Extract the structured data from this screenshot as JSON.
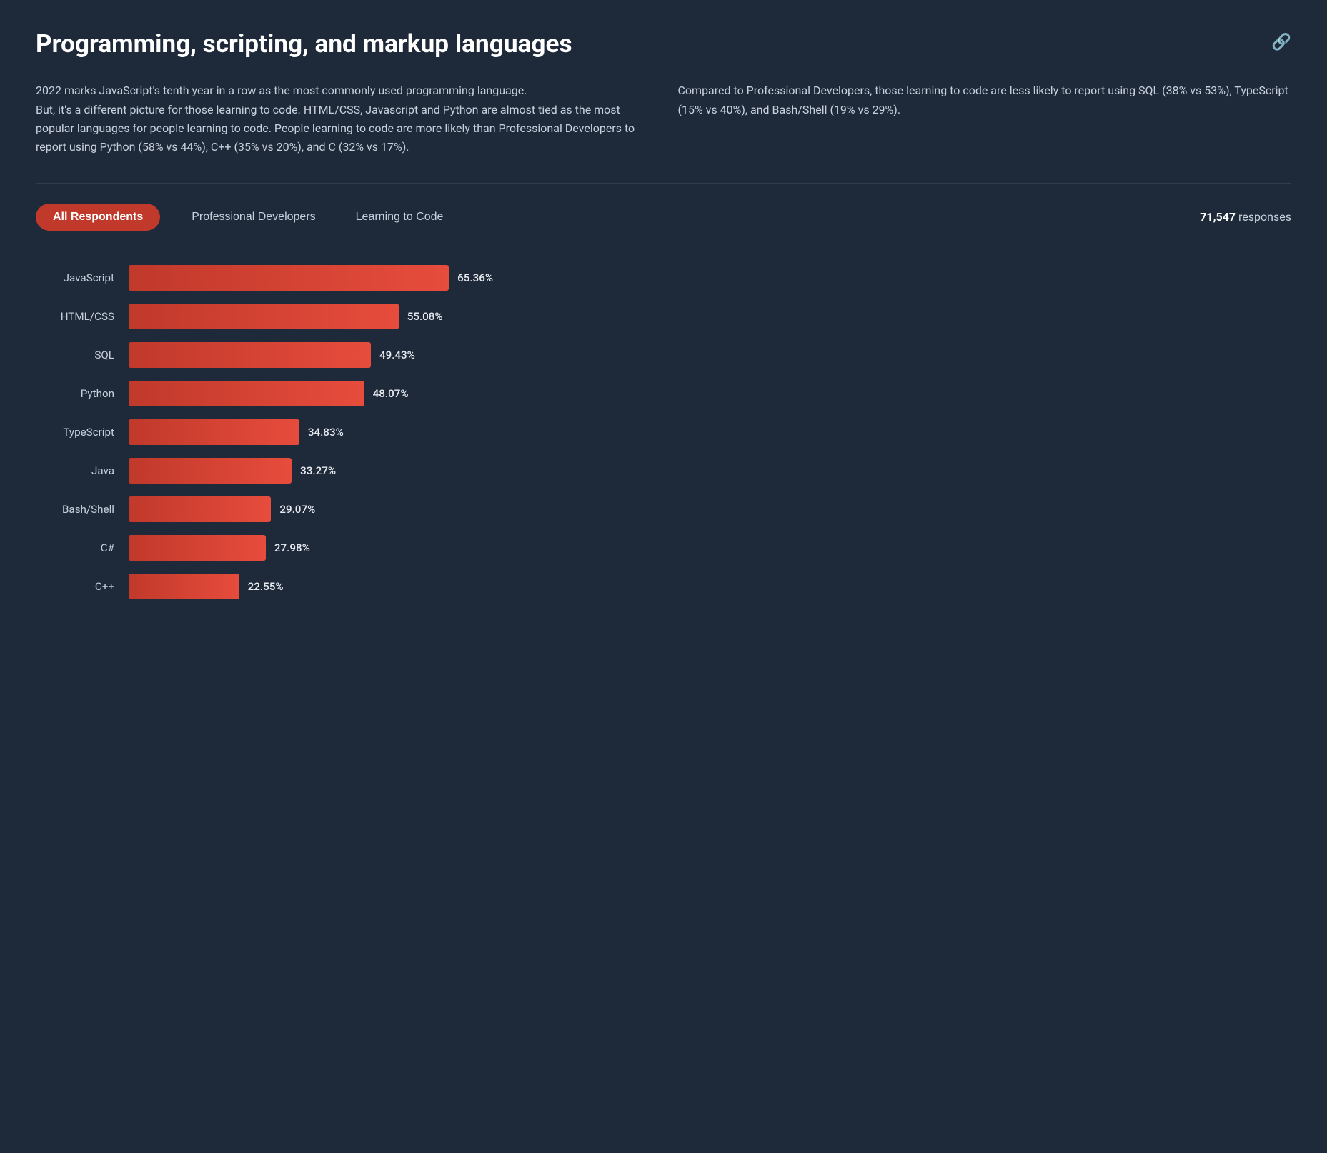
{
  "header": {
    "title": "Programming, scripting, and markup languages",
    "link_icon": "🔗"
  },
  "descriptions": {
    "left_p1": "2022 marks JavaScript's tenth year in a row as the most commonly used programming language.",
    "left_p2": "But, it's a different picture for those learning to code. HTML/CSS, Javascript and Python are almost tied as the most popular languages for people learning to code. People learning to code are more likely than Professional Developers to report using Python (58% vs 44%), C++ (35% vs 20%), and C (32% vs 17%).",
    "right_p1": "Compared to Professional Developers, those learning to code are less likely to report using SQL (38% vs 53%), TypeScript (15% vs 40%), and Bash/Shell (19% vs 29%)."
  },
  "tabs": {
    "active": "All Respondents",
    "items": [
      {
        "label": "All Respondents",
        "active": true
      },
      {
        "label": "Professional Developers",
        "active": false
      },
      {
        "label": "Learning to Code",
        "active": false
      }
    ],
    "response_count": "71,547",
    "response_label": "responses"
  },
  "chart": {
    "bars": [
      {
        "language": "JavaScript",
        "percent": "65.36%",
        "value": 65.36
      },
      {
        "language": "HTML/CSS",
        "percent": "55.08%",
        "value": 55.08
      },
      {
        "language": "SQL",
        "percent": "49.43%",
        "value": 49.43
      },
      {
        "language": "Python",
        "percent": "48.07%",
        "value": 48.07
      },
      {
        "language": "TypeScript",
        "percent": "34.83%",
        "value": 34.83
      },
      {
        "language": "Java",
        "percent": "33.27%",
        "value": 33.27
      },
      {
        "language": "Bash/Shell",
        "percent": "29.07%",
        "value": 29.07
      },
      {
        "language": "C#",
        "percent": "27.98%",
        "value": 27.98
      },
      {
        "language": "C++",
        "percent": "22.55%",
        "value": 22.55
      }
    ],
    "max_value": 70
  }
}
